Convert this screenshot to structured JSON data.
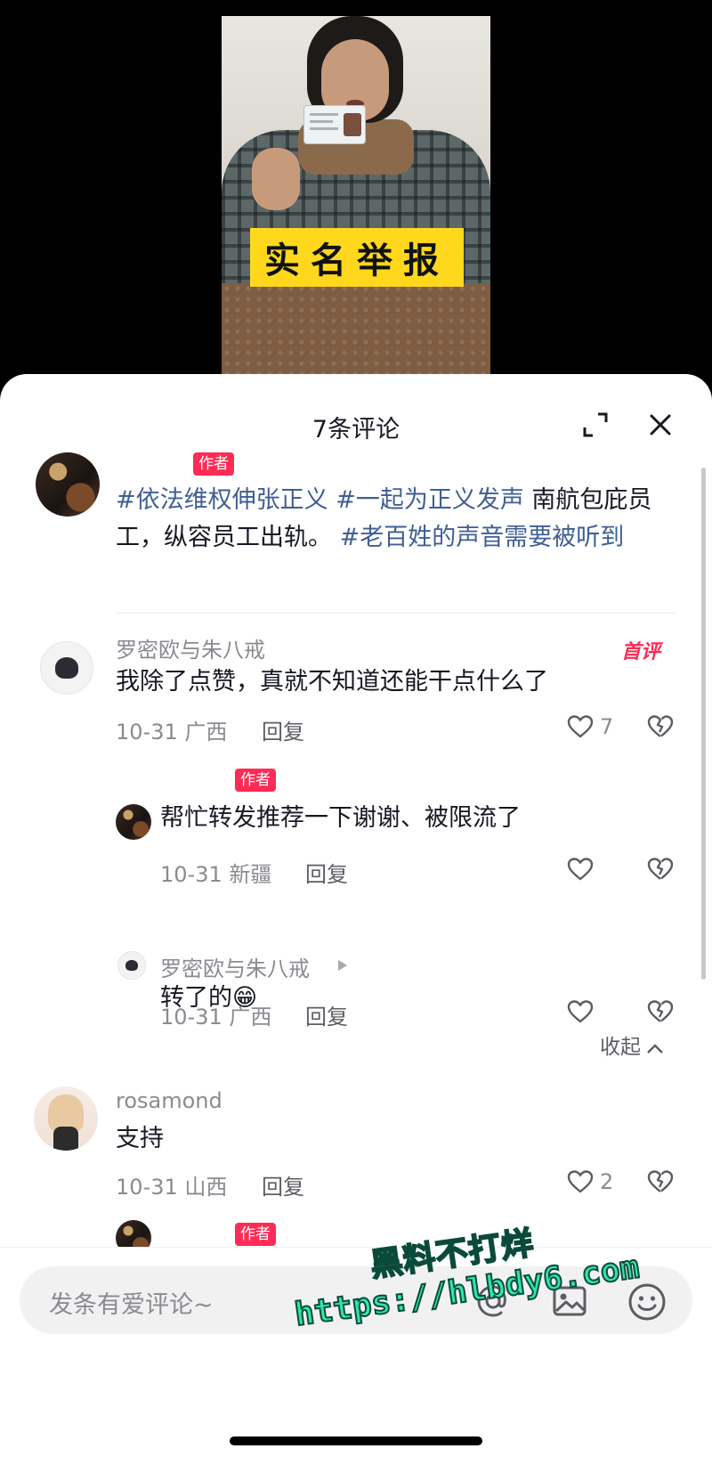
{
  "video": {
    "banner_text": "实名举报"
  },
  "sheet": {
    "title": "7条评论",
    "collapse_label": "收起"
  },
  "author_post": {
    "author_tag": "作者",
    "hashtag1": "#依法维权伸张正义",
    "hashtag2": "#一起为正义发声",
    "text1": " 南航包庇员工，纵容员工出轨。",
    "hashtag3": "#老百姓的声音需要被听到"
  },
  "comments": [
    {
      "username": "罗密欧与朱八戒",
      "badge": "首评",
      "text": "我除了点赞，真就不知道还能干点什么了",
      "date_location": "10-31 广西",
      "reply_label": "回复",
      "likes": "7"
    },
    {
      "author_tag": "作者",
      "text": "帮忙转发推荐一下谢谢、被限流了",
      "date_location": "10-31 新疆",
      "reply_label": "回复"
    },
    {
      "username": "罗密欧与朱八戒",
      "text": "转了的😁",
      "date_location": "10-31 广西",
      "reply_label": "回复"
    },
    {
      "username": "rosamond",
      "text": "支持",
      "date_location": "10-31 山西",
      "reply_label": "回复",
      "likes": "2"
    },
    {
      "author_tag": "作者"
    }
  ],
  "input": {
    "placeholder": "发条有爱评论~"
  },
  "watermark": {
    "line1": "黑料不打烊",
    "line2": "https://hlbdy6.com"
  },
  "colors": {
    "accent": "#fe2c55",
    "hashtag": "#3f5f94",
    "banner": "#ffd81e"
  }
}
